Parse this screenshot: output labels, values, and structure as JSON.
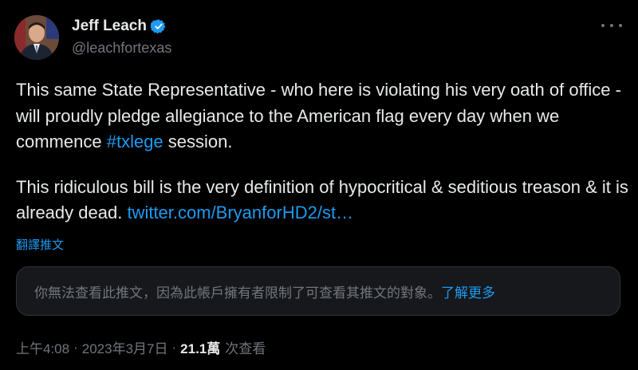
{
  "author": {
    "display_name": "Jeff Leach",
    "handle": "@leachfortexas",
    "verified": true
  },
  "tweet": {
    "paragraph1_text": "This same State Representative - who here is violating his very oath of office - will proudly pledge allegiance to the American flag every day when we commence ",
    "hashtag": "#txlege",
    "paragraph1_end": " session.",
    "paragraph2_text": "This ridiculous bill is the very definition of hypocritical & seditious treason & it is already dead. ",
    "link": "twitter.com/BryanforHD2/st…"
  },
  "translate_label": "翻譯推文",
  "quoted_notice": {
    "text": "你無法查看此推文，因為此帳戶擁有者限制了可查看其推文的對象。",
    "learn_more": "了解更多"
  },
  "meta": {
    "time": "上午4:08",
    "separator": "·",
    "date": "2023年3月7日",
    "views_count": "21.1萬",
    "views_label": "次查看"
  },
  "colors": {
    "background": "#000000",
    "text": "#e7e9ea",
    "secondary": "#71767b",
    "accent": "#1d9bf0",
    "card": "#16181c"
  },
  "icons": {
    "verified": "verified-badge-icon",
    "more": "more-options-icon"
  }
}
